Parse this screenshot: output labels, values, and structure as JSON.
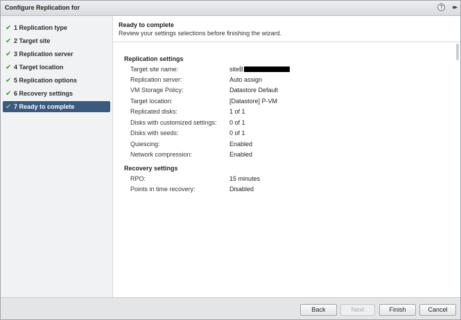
{
  "window": {
    "title": "Configure Replication for",
    "help_glyph": "?",
    "expand_glyph": "▸▸"
  },
  "sidebar": {
    "check_glyph": "✔",
    "items": [
      {
        "label": "1  Replication type",
        "completed": true,
        "active": false
      },
      {
        "label": "2  Target site",
        "completed": true,
        "active": false
      },
      {
        "label": "3  Replication server",
        "completed": true,
        "active": false
      },
      {
        "label": "4  Target location",
        "completed": true,
        "active": false
      },
      {
        "label": "5  Replication options",
        "completed": true,
        "active": false
      },
      {
        "label": "6  Recovery settings",
        "completed": true,
        "active": false
      },
      {
        "label": "7  Ready to complete",
        "completed": true,
        "active": true
      }
    ]
  },
  "header": {
    "title": "Ready to complete",
    "subtitle": "Review your settings selections before finishing the wizard."
  },
  "replication_settings": {
    "title": "Replication settings",
    "rows": [
      {
        "label": "Target site name:",
        "value": "siteB",
        "redacted": true
      },
      {
        "label": "Replication server:",
        "value": "Auto assign"
      },
      {
        "label": "VM Storage Policy:",
        "value": "Datastore Default"
      },
      {
        "label": "Target location:",
        "value": "[Datastore] P-VM"
      },
      {
        "label": "Replicated disks:",
        "value": "1 of 1"
      },
      {
        "label": "Disks with customized settings:",
        "value": "0 of 1"
      },
      {
        "label": "Disks with seeds:",
        "value": "0 of 1"
      },
      {
        "label": "Quiescing:",
        "value": "Enabled"
      },
      {
        "label": "Network compression:",
        "value": "Enabled"
      }
    ]
  },
  "recovery_settings": {
    "title": "Recovery settings",
    "rows": [
      {
        "label": "RPO:",
        "value": "15 minutes"
      },
      {
        "label": "Points in time recovery:",
        "value": "Disabled"
      }
    ]
  },
  "footer": {
    "back_label": "Back",
    "next_label": "Next",
    "finish_label": "Finish",
    "cancel_label": "Cancel"
  },
  "colors": {
    "active_step_bg": "#3a5a80",
    "check_green": "#3e9b2f"
  }
}
